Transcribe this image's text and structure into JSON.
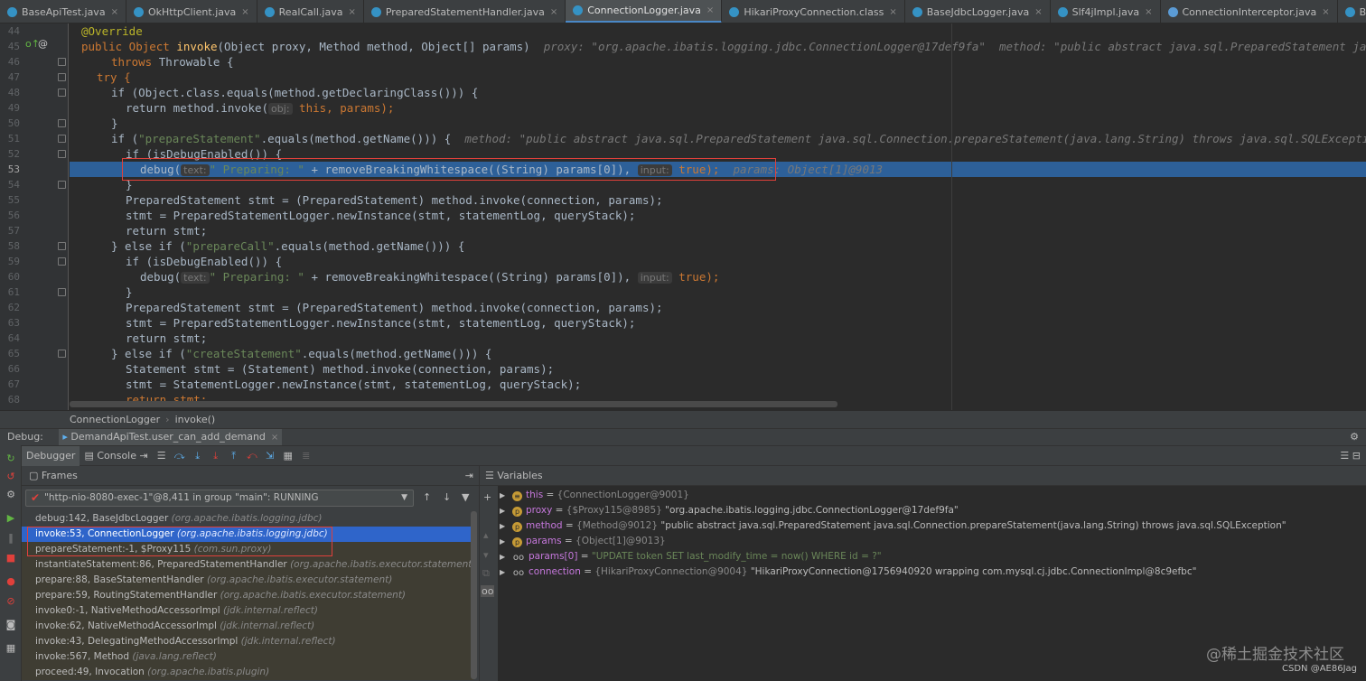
{
  "tabs": [
    {
      "label": "BaseApiTest.java",
      "kind": "class",
      "active": false
    },
    {
      "label": "OkHttpClient.java",
      "kind": "class",
      "active": false
    },
    {
      "label": "RealCall.java",
      "kind": "class",
      "active": false
    },
    {
      "label": "PreparedStatementHandler.java",
      "kind": "class",
      "active": false
    },
    {
      "label": "ConnectionLogger.java",
      "kind": "class",
      "active": true
    },
    {
      "label": "HikariProxyConnection.class",
      "kind": "class",
      "active": false
    },
    {
      "label": "BaseJdbcLogger.java",
      "kind": "class",
      "active": false
    },
    {
      "label": "Slf4jImpl.java",
      "kind": "class",
      "active": false
    },
    {
      "label": "ConnectionInterceptor.java",
      "kind": "interface",
      "active": false
    },
    {
      "label": "BaseStatementHandler.java",
      "kind": "class",
      "active": false
    }
  ],
  "editor": {
    "line_numbers": [
      "44",
      "45",
      "46",
      "47",
      "48",
      "49",
      "50",
      "51",
      "52",
      "53",
      "54",
      "55",
      "56",
      "57",
      "58",
      "59",
      "60",
      "61",
      "62",
      "63",
      "64",
      "65",
      "66",
      "67",
      "68"
    ],
    "current_line": "53",
    "gutter_marks": {
      "override": "o↑",
      "annotation": "@"
    },
    "lines": {
      "l44": "@Override",
      "l45a": "public Object ",
      "l45b": "invoke",
      "l45c": "(Object proxy, Method method, Object[] params)  ",
      "l45d": "proxy: \"org.apache.ibatis.logging.jdbc.ConnectionLogger@17def9fa\"  method: \"public abstract java.sql.PreparedStatement java.sql.Connection.prepareStatement(java.lang.String) throws java.sql.SQLException\"",
      "l46a": "throws ",
      "l46b": "Throwable {",
      "l47": "try {",
      "l48": "if (Object.class.equals(method.getDeclaringClass())) {",
      "l49a": "return method.invoke(",
      "l49h": "obj:",
      "l49b": " this, params);",
      "l50": "}",
      "l51a": "if (",
      "l51s": "\"prepareStatement\"",
      "l51b": ".equals(method.getName())) {  ",
      "l51d": "method: \"public abstract java.sql.PreparedStatement java.sql.Connection.prepareStatement(java.lang.String) throws java.sql.SQLException\"",
      "l52": "if (isDebugEnabled()) {",
      "l53a": "debug(",
      "l53h1": "text:",
      "l53s": "\" Preparing: \"",
      "l53b": " + removeBreakingWhitespace((String) params[0]),",
      "l53h2": "input:",
      "l53c": " true);",
      "l53d": "params: Object[1]@9013",
      "l54": "}",
      "l55": "PreparedStatement stmt = (PreparedStatement) method.invoke(connection, params);",
      "l56": "stmt = PreparedStatementLogger.newInstance(stmt, statementLog, queryStack);",
      "l57": "return stmt;",
      "l58a": "} else if (",
      "l58s": "\"prepareCall\"",
      "l58b": ".equals(method.getName())) {",
      "l59": "if (isDebugEnabled()) {",
      "l60a": "debug(",
      "l60h1": "text:",
      "l60s": "\" Preparing: \"",
      "l60b": " + removeBreakingWhitespace((String) params[0]),",
      "l60h2": "input:",
      "l60c": " true);",
      "l61": "}",
      "l62": "PreparedStatement stmt = (PreparedStatement) method.invoke(connection, params);",
      "l63": "stmt = PreparedStatementLogger.newInstance(stmt, statementLog, queryStack);",
      "l64": "return stmt;",
      "l65a": "} else if (",
      "l65s": "\"createStatement\"",
      "l65b": ".equals(method.getName())) {",
      "l66": "Statement stmt = (Statement) method.invoke(connection, params);",
      "l67": "stmt = StatementLogger.newInstance(stmt, statementLog, queryStack);",
      "l68": "return stmt;"
    }
  },
  "breadcrumb": {
    "class": "ConnectionLogger",
    "method": "invoke()"
  },
  "debug": {
    "label": "Debug:",
    "session": "DemandApiTest.user_can_add_demand",
    "tab_debugger": "Debugger",
    "tab_console": "Console",
    "frames_title": "Frames",
    "variables_title": "Variables",
    "thread": "\"http-nio-8080-exec-1\"@8,411 in group \"main\": RUNNING",
    "frames": [
      {
        "method": "debug:142, BaseJdbcLogger ",
        "pkg": "(org.apache.ibatis.logging.jdbc)",
        "style": "normal"
      },
      {
        "method": "invoke:53, ConnectionLogger ",
        "pkg": "(org.apache.ibatis.logging.jdbc)",
        "style": "sel"
      },
      {
        "method": "prepareStatement:-1, $Proxy115 ",
        "pkg": "(com.sun.proxy)",
        "style": "lib"
      },
      {
        "method": "instantiateStatement:86, PreparedStatementHandler ",
        "pkg": "(org.apache.ibatis.executor.statement)",
        "style": "lib"
      },
      {
        "method": "prepare:88, BaseStatementHandler ",
        "pkg": "(org.apache.ibatis.executor.statement)",
        "style": "lib"
      },
      {
        "method": "prepare:59, RoutingStatementHandler ",
        "pkg": "(org.apache.ibatis.executor.statement)",
        "style": "lib"
      },
      {
        "method": "invoke0:-1, NativeMethodAccessorImpl ",
        "pkg": "(jdk.internal.reflect)",
        "style": "lib"
      },
      {
        "method": "invoke:62, NativeMethodAccessorImpl ",
        "pkg": "(jdk.internal.reflect)",
        "style": "lib"
      },
      {
        "method": "invoke:43, DelegatingMethodAccessorImpl ",
        "pkg": "(jdk.internal.reflect)",
        "style": "lib"
      },
      {
        "method": "invoke:567, Method ",
        "pkg": "(java.lang.reflect)",
        "style": "lib"
      },
      {
        "method": "proceed:49, Invocation ",
        "pkg": "(org.apache.ibatis.plugin)",
        "style": "lib"
      }
    ],
    "variables": [
      {
        "icon": "≡",
        "name": "this",
        "eq": " = ",
        "type": "{ConnectionLogger@9001}",
        "value": ""
      },
      {
        "icon": "p",
        "name": "proxy",
        "eq": " = ",
        "type": "{$Proxy115@8985} ",
        "value": "\"org.apache.ibatis.logging.jdbc.ConnectionLogger@17def9fa\""
      },
      {
        "icon": "p",
        "name": "method",
        "eq": " = ",
        "type": "{Method@9012} ",
        "value": "\"public abstract java.sql.PreparedStatement java.sql.Connection.prepareStatement(java.lang.String) throws java.sql.SQLException\""
      },
      {
        "icon": "p",
        "name": "params",
        "eq": " = ",
        "type": "{Object[1]@9013}",
        "value": ""
      },
      {
        "icon": "oo",
        "name": "params[0]",
        "eq": " = ",
        "type": "",
        "value": "\"UPDATE token SET last_modify_time = now() WHERE id = ?\""
      },
      {
        "icon": "oo",
        "name": "connection",
        "eq": " = ",
        "type": "{HikariProxyConnection@9004} ",
        "value": "\"HikariProxyConnection@1756940920 wrapping com.mysql.cj.jdbc.ConnectionImpl@8c9efbc\""
      }
    ]
  },
  "watermark": "@稀土掘金技术社区",
  "watermark_small": "CSDN @AE86Jag",
  "colors": {
    "accent": "#2f65ca",
    "current_line": "#2d6099",
    "highlight_box": "#e0403b"
  }
}
